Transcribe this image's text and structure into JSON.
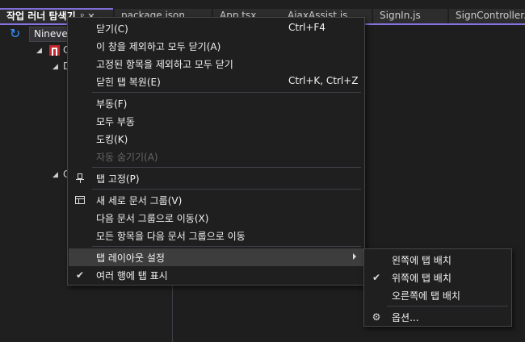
{
  "tabs": [
    {
      "label": "작업 러너 탐색기",
      "active": true,
      "pin": "ᵖ",
      "close": "✕"
    },
    {
      "label": "package.json"
    },
    {
      "label": "App.tsx"
    },
    {
      "label": "AjaxAssist.js"
    },
    {
      "label": "SignIn.js"
    },
    {
      "label": "SignController.cs"
    }
  ],
  "tool_window": {
    "project_combo": "Nineveh",
    "tree": [
      {
        "label": "C"
      },
      {
        "label": "D"
      },
      {
        "label": "C"
      }
    ]
  },
  "context_menu": {
    "items": [
      {
        "label": "닫기(C)",
        "shortcut": "Ctrl+F4"
      },
      {
        "label": "이 창을 제외하고 모두 닫기(A)"
      },
      {
        "label": "고정된 항목을 제외하고 모두 닫기"
      },
      {
        "label": "닫힌 탭 복원(E)",
        "shortcut": "Ctrl+K, Ctrl+Z"
      },
      {
        "label": "부동(F)"
      },
      {
        "label": "모두 부동"
      },
      {
        "label": "도킹(K)"
      },
      {
        "label": "자동 숨기기(A)",
        "disabled": true
      },
      {
        "label": "탭 고정(P)",
        "icon": "pin-icon"
      },
      {
        "label": "새 세로 문서 그룹(V)",
        "icon": "vertical-group-icon"
      },
      {
        "label": "다음 문서 그룹으로 이동(X)"
      },
      {
        "label": "모든 항목을 다음 문서 그룹으로 이동"
      },
      {
        "label": "탭 레이아웃 설정",
        "submenu": true,
        "highlighted": true
      },
      {
        "label": "여러 행에 탭 표시",
        "checked": true
      }
    ]
  },
  "tab_layout_submenu": {
    "items": [
      {
        "label": "왼쪽에 탭 배치"
      },
      {
        "label": "위쪽에 탭 배치",
        "checked": true
      },
      {
        "label": "오른쪽에 탭 배치"
      },
      {
        "label": "옵션...",
        "icon": "gear-icon"
      }
    ]
  },
  "glyphs": {
    "check": "✔",
    "refresh": "↻",
    "tree_expanded": "◢",
    "gear": "⚙"
  },
  "colors": {
    "accent": "#8672e0",
    "menu_bg": "#1f1f1f",
    "highlight": "#3d3d3d"
  }
}
